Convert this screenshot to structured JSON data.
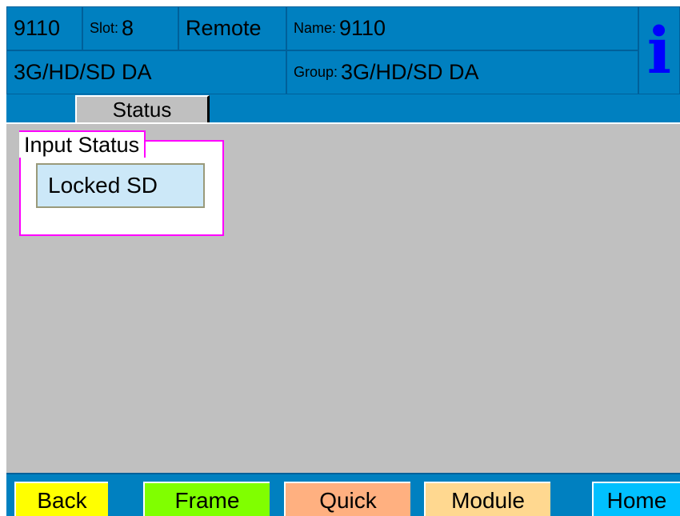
{
  "header": {
    "id": "9110",
    "slot_label": "Slot:",
    "slot_value": "8",
    "mode": "Remote",
    "name_label": "Name:",
    "name_value": "9110",
    "card_type": "3G/HD/SD DA",
    "group_label": "Group:",
    "group_value": "3G/HD/SD DA",
    "info_icon": "i"
  },
  "tabs": [
    {
      "label": "Status"
    }
  ],
  "main": {
    "input_status": {
      "title": "Input Status",
      "value": "Locked SD"
    }
  },
  "footer": {
    "buttons": [
      {
        "label": "Back",
        "color": "#ffff00"
      },
      {
        "label": "Frame",
        "color": "#80ff00"
      },
      {
        "label": "Quick",
        "color": "#ffb080"
      },
      {
        "label": "Module",
        "color": "#ffd890"
      },
      {
        "label": "Home",
        "color": "#00c0ff"
      }
    ]
  },
  "colors": {
    "header_bg": "#0080c0",
    "body_bg": "#c0c0c0",
    "group_border": "#ff00ff",
    "info_icon": "#0000ff"
  }
}
